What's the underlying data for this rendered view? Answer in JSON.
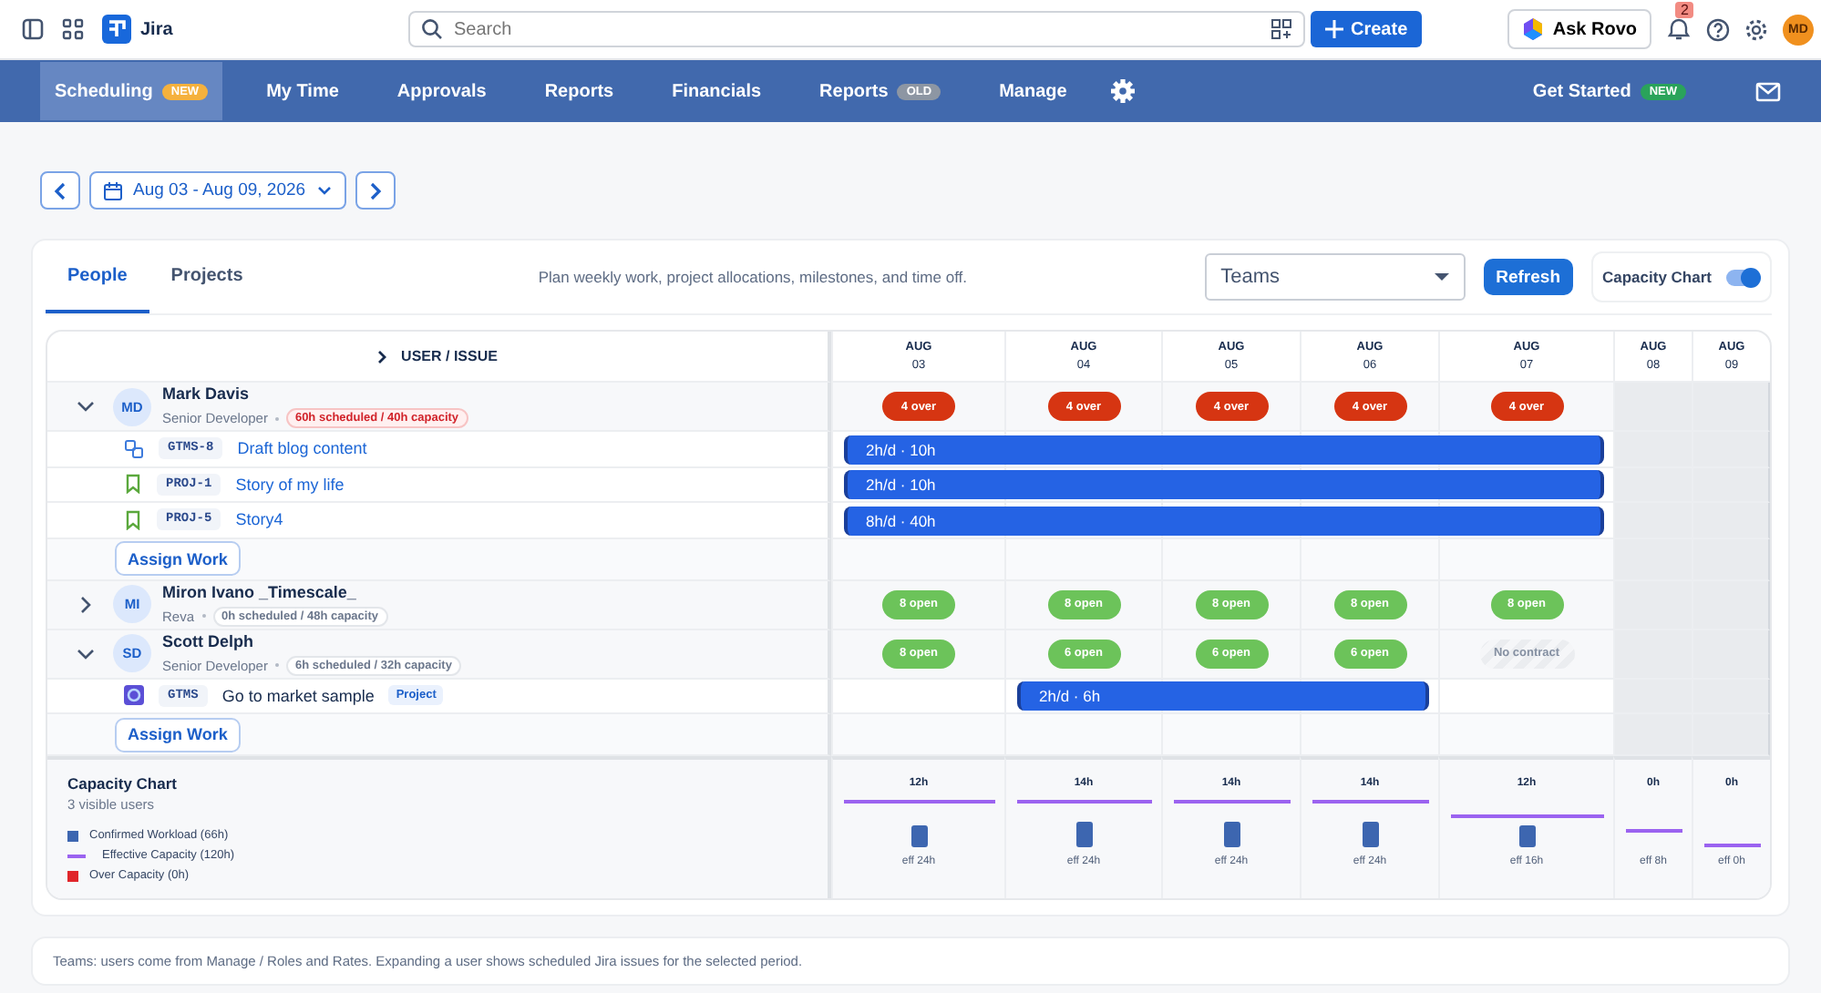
{
  "topbar": {
    "app_name": "Jira",
    "search": {
      "placeholder": "Search"
    },
    "create_button": "Create",
    "ask_button": "Ask Rovo",
    "notification_count": "2",
    "avatar": "MD"
  },
  "nav": {
    "items": [
      {
        "label": "Scheduling",
        "selected": true,
        "badge": {
          "text": "NEW",
          "color": "#f5b13d"
        }
      },
      {
        "label": "My Time",
        "selected": false
      },
      {
        "label": "Approvals",
        "selected": false
      },
      {
        "label": "Reports",
        "selected": false
      },
      {
        "label": "Financials",
        "selected": false
      },
      {
        "label": "Reports",
        "selected": false,
        "badge": {
          "text": "OLD",
          "color": "#8d96a3"
        }
      },
      {
        "label": "Manage",
        "selected": false
      }
    ],
    "get_started": {
      "label": "Get Started",
      "badge": {
        "text": "NEW",
        "color": "#2aa35a"
      }
    }
  },
  "date_range": "Aug 03 - Aug 09, 2026",
  "view_tabs": [
    {
      "label": "People",
      "selected": true
    },
    {
      "label": "Projects",
      "selected": false
    }
  ],
  "description": "Plan weekly work, project allocations, milestones, and time off.",
  "team_select": {
    "value": "Teams"
  },
  "refresh_button": "Refresh",
  "capacity_toggle": {
    "label": "Capacity Chart",
    "on": true
  },
  "schedule": {
    "header": "USER / ISSUE",
    "days": [
      {
        "month": "AUG",
        "day": "03",
        "weekend": false
      },
      {
        "month": "AUG",
        "day": "04",
        "weekend": false
      },
      {
        "month": "AUG",
        "day": "05",
        "weekend": false
      },
      {
        "month": "AUG",
        "day": "06",
        "weekend": false
      },
      {
        "month": "AUG",
        "day": "07",
        "weekend": false
      },
      {
        "month": "AUG",
        "day": "08",
        "weekend": true
      },
      {
        "month": "AUG",
        "day": "09",
        "weekend": true
      }
    ],
    "users": [
      {
        "initials": "MD",
        "name": "Mark Davis",
        "role": "Senior Developer",
        "summary": "60h scheduled / 40h capacity",
        "over": true,
        "expanded": true,
        "day_badges": [
          {
            "text": "4 over",
            "kind": "over"
          },
          {
            "text": "4 over",
            "kind": "over"
          },
          {
            "text": "4 over",
            "kind": "over"
          },
          {
            "text": "4 over",
            "kind": "over"
          },
          {
            "text": "4 over",
            "kind": "over"
          }
        ],
        "issues": [
          {
            "kind": "subtask",
            "key": "GTMS-8",
            "title": "Draft blog content",
            "bar": "2h/d · 10h",
            "scheduled": [
              true,
              true,
              true,
              true,
              true,
              false,
              false
            ]
          },
          {
            "kind": "story",
            "key": "PROJ-1",
            "title": "Story of my life",
            "bar": "2h/d · 10h",
            "scheduled": [
              true,
              true,
              true,
              true,
              true,
              false,
              false
            ]
          },
          {
            "kind": "story",
            "key": "PROJ-5",
            "title": "Story4",
            "bar": "8h/d · 40h",
            "scheduled": [
              true,
              true,
              true,
              true,
              true,
              false,
              false
            ]
          }
        ],
        "assign_button": "Assign Work"
      },
      {
        "initials": "MI",
        "name": "Miron Ivano _Timescale_",
        "role": "Reva",
        "summary": "0h scheduled / 48h capacity",
        "over": false,
        "expanded": false,
        "day_badges": [
          {
            "text": "8 open",
            "kind": "open"
          },
          {
            "text": "8 open",
            "kind": "open"
          },
          {
            "text": "8 open",
            "kind": "open"
          },
          {
            "text": "8 open",
            "kind": "open"
          },
          {
            "text": "8 open",
            "kind": "open"
          }
        ]
      },
      {
        "initials": "SD",
        "name": "Scott Delph",
        "role": "Senior Developer",
        "summary": "6h scheduled / 32h capacity",
        "over": false,
        "expanded": true,
        "day_badges": [
          {
            "text": "8 open",
            "kind": "open"
          },
          {
            "text": "6 open",
            "kind": "open"
          },
          {
            "text": "6 open",
            "kind": "open"
          },
          {
            "text": "6 open",
            "kind": "open"
          },
          {
            "text": "No contract",
            "kind": "none"
          }
        ],
        "issues": [
          {
            "kind": "project",
            "key": "GTMS",
            "title": "Go to market sample",
            "tag": "Project",
            "bar": "2h/d · 6h",
            "scheduled": [
              false,
              true,
              true,
              true,
              false,
              false,
              false
            ]
          }
        ],
        "assign_button": "Assign Work"
      }
    ]
  },
  "capacity_chart": {
    "title": "Capacity Chart",
    "subtitle": "3 visible users",
    "legend": [
      {
        "kind": "bar",
        "label": "Confirmed Workload (66h)",
        "color": "#3d66b0"
      },
      {
        "kind": "line",
        "label": "Effective Capacity (120h)",
        "color": "#9b63f0"
      },
      {
        "kind": "bar",
        "label": "Over Capacity (0h)",
        "color": "#e0262b"
      }
    ],
    "days": [
      {
        "total": "12h",
        "eff": "eff 24h"
      },
      {
        "total": "14h",
        "eff": "eff 24h"
      },
      {
        "total": "14h",
        "eff": "eff 24h"
      },
      {
        "total": "14h",
        "eff": "eff 24h"
      },
      {
        "total": "12h",
        "eff": "eff 16h"
      },
      {
        "total": "0h",
        "eff": "eff 8h"
      },
      {
        "total": "0h",
        "eff": "eff 0h"
      }
    ]
  },
  "note": "Teams: users come from Manage / Roles and Rates. Expanding a user shows scheduled Jira issues for the selected period."
}
